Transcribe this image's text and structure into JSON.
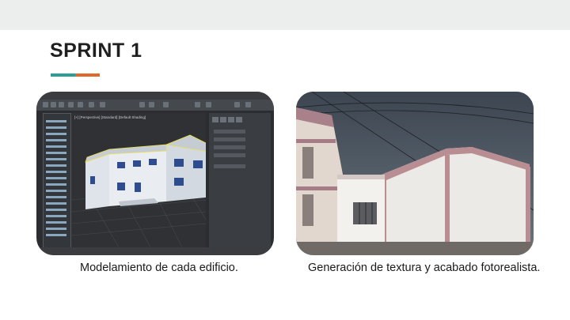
{
  "slide": {
    "title": "SPRINT 1",
    "accent_colors": [
      "#2a9d96",
      "#e0682a"
    ],
    "captions": {
      "left": "Modelamiento de cada edificio.",
      "right": "Generación de textura y acabado fotorealista."
    }
  },
  "left_image": {
    "subject": "3D modeling software screenshot of a two-storey building",
    "viewport_label": "[+] [Perspective] [Standard] [Default Shading]"
  },
  "right_image": {
    "subject": "photorealistic rendering of a house facade with textures under a cloudy sky"
  }
}
